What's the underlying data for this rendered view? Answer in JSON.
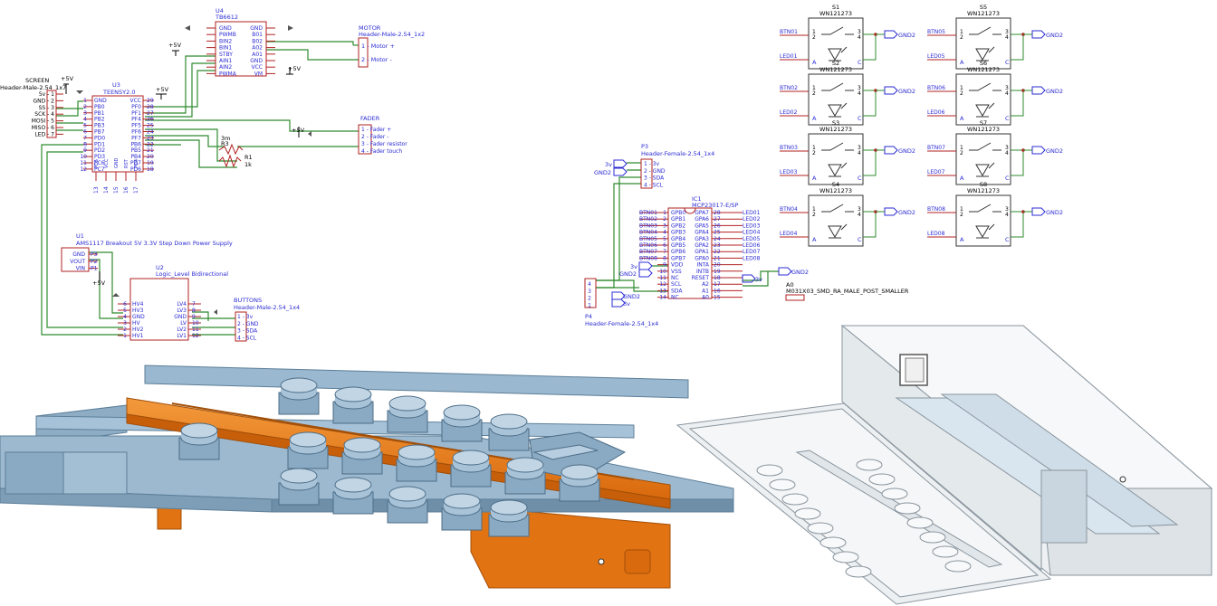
{
  "colors": {
    "wire": "#2e8b2e",
    "component": "#b22222",
    "text": "#2b2bd4",
    "power": "#000000",
    "blue_part": "#8fb0cc",
    "orange_part": "#e87a14",
    "enclosure": "#e8ecef"
  },
  "u4": {
    "ref": "U4",
    "value": "TB6612",
    "left_pins": [
      "GND",
      "PWMB",
      "BIN2",
      "BIN1",
      "STBY",
      "AIN1",
      "AIN2",
      "PWMA"
    ],
    "right_pins": [
      "GND",
      "B01",
      "B02",
      "A02",
      "A01",
      "GND",
      "VCC",
      "VM"
    ]
  },
  "motor": {
    "name": "MOTOR",
    "value": "Header-Male-2.54_1x2",
    "pins": [
      "1 - Motor +",
      "2 - Motor -"
    ]
  },
  "screen": {
    "name": "SCREEN",
    "value": "Header-Male-2.54_1x7",
    "pins": [
      "5v - 1",
      "GND - 2",
      "SS - 3",
      "SCK - 4",
      "MOSI - 5",
      "MISO - 6",
      "LED - 7"
    ]
  },
  "u3": {
    "ref": "U3",
    "value": "TEENSY2.0",
    "left_nums": [
      "1",
      "2",
      "3",
      "4",
      "5",
      "6",
      "7",
      "8",
      "9",
      "10",
      "11",
      "12"
    ],
    "left_pins": [
      "GND",
      "PB0",
      "PB1",
      "PB2",
      "PB3",
      "PB7",
      "PD0",
      "PD1",
      "PD2",
      "PD3",
      "PC6",
      "PC7"
    ],
    "right_pins": [
      "VCC",
      "PF0",
      "PF1",
      "PF4",
      "PF5",
      "PF6",
      "PF7",
      "PB6",
      "PB5",
      "PB4",
      "PD7",
      "PD6"
    ],
    "right_nums": [
      "29",
      "28",
      "27",
      "26",
      "25",
      "24",
      "23",
      "22",
      "21",
      "20",
      "19",
      "18"
    ],
    "bottom_pins": [
      "PD5",
      "VCC",
      "GND",
      "RST",
      "PD4"
    ],
    "bottom_nums": [
      "13",
      "14",
      "15",
      "16",
      "17"
    ]
  },
  "fader": {
    "name": "FADER",
    "pins": [
      "1 - Fader +",
      "2 - Fader -",
      "3 - Fader resistor",
      "4 - Fader touch"
    ]
  },
  "r": {
    "r3": "R3",
    "r3_val": "3m",
    "r1": "R1",
    "r1_val": "1k"
  },
  "power": {
    "p5v": "+5V",
    "p3v": "3v",
    "gnd2": "GND2"
  },
  "u1": {
    "ref": "U1",
    "value": "AMS1117 Breakout 5V 3.3V Step Down Power Supply",
    "pins": [
      "GND",
      "VOUT",
      "VIN"
    ],
    "nums": [
      "P3",
      "P2",
      "P1"
    ]
  },
  "u2": {
    "ref": "U2",
    "value": "Logic_Level Bidirectional",
    "left_nums": [
      "6",
      "5",
      "4",
      "3",
      "2",
      "1"
    ],
    "left_pins": [
      "HV4",
      "HV3",
      "GND",
      "HV",
      "HV2",
      "HV1"
    ],
    "right_pins": [
      "LV4",
      "LV3",
      "GND",
      "LV",
      "LV2",
      "LV1"
    ],
    "right_nums": [
      "7",
      "8",
      "9",
      "10",
      "11",
      "12"
    ]
  },
  "buttons": {
    "name": "BUTTONS",
    "value": "Header-Male-2.54_1x4",
    "pins": [
      "1 - 3v",
      "2 - GND",
      "3 - SDA",
      "4 - SCL"
    ]
  },
  "p3": {
    "ref": "P3",
    "value": "Header-Female-2.54_1x4",
    "pins": [
      "1 - 3v",
      "2 - GND",
      "3 - SDA",
      "4 - SCL"
    ]
  },
  "p4": {
    "ref": "P4",
    "value": "Header-Female-2.54_1x4",
    "nums": [
      "4",
      "3",
      "2",
      "1"
    ]
  },
  "ic1": {
    "ref": "IC1",
    "value": "MCP23017-E/SP",
    "btn_nets": [
      "BTN01",
      "BTN02",
      "BTN03",
      "BTN04",
      "BTN05",
      "BTN06",
      "BTN07",
      "BTN08"
    ],
    "left_nums": [
      "1",
      "2",
      "3",
      "4",
      "5",
      "6",
      "7",
      "8",
      "9",
      "10",
      "11",
      "12",
      "13",
      "14"
    ],
    "left_pins": [
      "GPB0",
      "GPB1",
      "GPB2",
      "GPB3",
      "GPB4",
      "GPB5",
      "GPB6",
      "GPB7",
      "VDD",
      "VSS",
      "NC",
      "SCL",
      "SDA",
      "NC"
    ],
    "right_pins": [
      "GPA7",
      "GPA6",
      "GPA5",
      "GPA4",
      "GPA3",
      "GPA2",
      "GPA1",
      "GPA0",
      "INTA",
      "INTB",
      "RESET",
      "A2",
      "A1",
      "A0"
    ],
    "right_nums": [
      "28",
      "27",
      "26",
      "25",
      "24",
      "23",
      "22",
      "21",
      "20",
      "19",
      "18",
      "17",
      "16",
      "15"
    ],
    "led_nets": [
      "LED01",
      "LED02",
      "LED03",
      "LED04",
      "LED05",
      "LED06",
      "LED07",
      "LED08"
    ]
  },
  "a0": {
    "ref": "A0",
    "value": "M031X03_SMD_RA_MALE_POST_SMALLER"
  },
  "switches": [
    {
      "ref": "S1",
      "value": "WN121273",
      "btn": "BTN01",
      "led": "LED01"
    },
    {
      "ref": "S2",
      "value": "WN121273",
      "btn": "BTN02",
      "led": "LED02"
    },
    {
      "ref": "S3",
      "value": "WN121273",
      "btn": "BTN03",
      "led": "LED03"
    },
    {
      "ref": "S4",
      "value": "WN121273",
      "btn": "BTN04",
      "led": "LED04"
    },
    {
      "ref": "S5",
      "value": "WN121273",
      "btn": "BTN05",
      "led": "LED05"
    },
    {
      "ref": "S6",
      "value": "WN121273",
      "btn": "BTN06",
      "led": "LED06"
    },
    {
      "ref": "S7",
      "value": "WN121273",
      "btn": "BTN07",
      "led": "LED07"
    },
    {
      "ref": "S8",
      "value": "WN121273",
      "btn": "BTN08",
      "led": "LED08"
    }
  ],
  "switch_pins": {
    "p1": "1",
    "p2": "2",
    "p3": "3",
    "p4": "4",
    "a": "A",
    "c": "C"
  }
}
